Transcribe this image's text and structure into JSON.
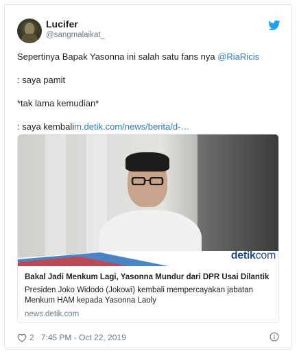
{
  "tweet": {
    "author_name": "Lucifer",
    "author_handle": "@sangmalaikat_",
    "text_line1": "Sepertinya Bapak Yasonna ini salah satu fans nya ",
    "mention": "@RiaRicis",
    "text_line2": ": saya pamit",
    "text_line3": "*tak lama kemudian*",
    "text_line4": ": saya kembali",
    "link": "m.detik.com/news/berita/d-…",
    "likes": "2",
    "timestamp": "7:45 PM - Oct 22, 2019"
  },
  "card": {
    "brand_main": "detik",
    "brand_suffix": "com",
    "title": "Bakal Jadi Menkum Lagi, Yasonna Mundur dari DPR Usai Dilantik",
    "description": "Presiden Joko Widodo (Jokowi) kembali mempercayakan jabatan Menkum HAM kepada Yasonna Laoly",
    "domain": "news.detik.com"
  },
  "icons": {
    "platform": "twitter-bird-icon",
    "like": "heart-icon",
    "info": "info-icon"
  },
  "colors": {
    "link": "#2b7bb9",
    "twitter_blue": "#1da1f2",
    "muted": "#697882",
    "brand_blue": "#1f4b8a"
  }
}
